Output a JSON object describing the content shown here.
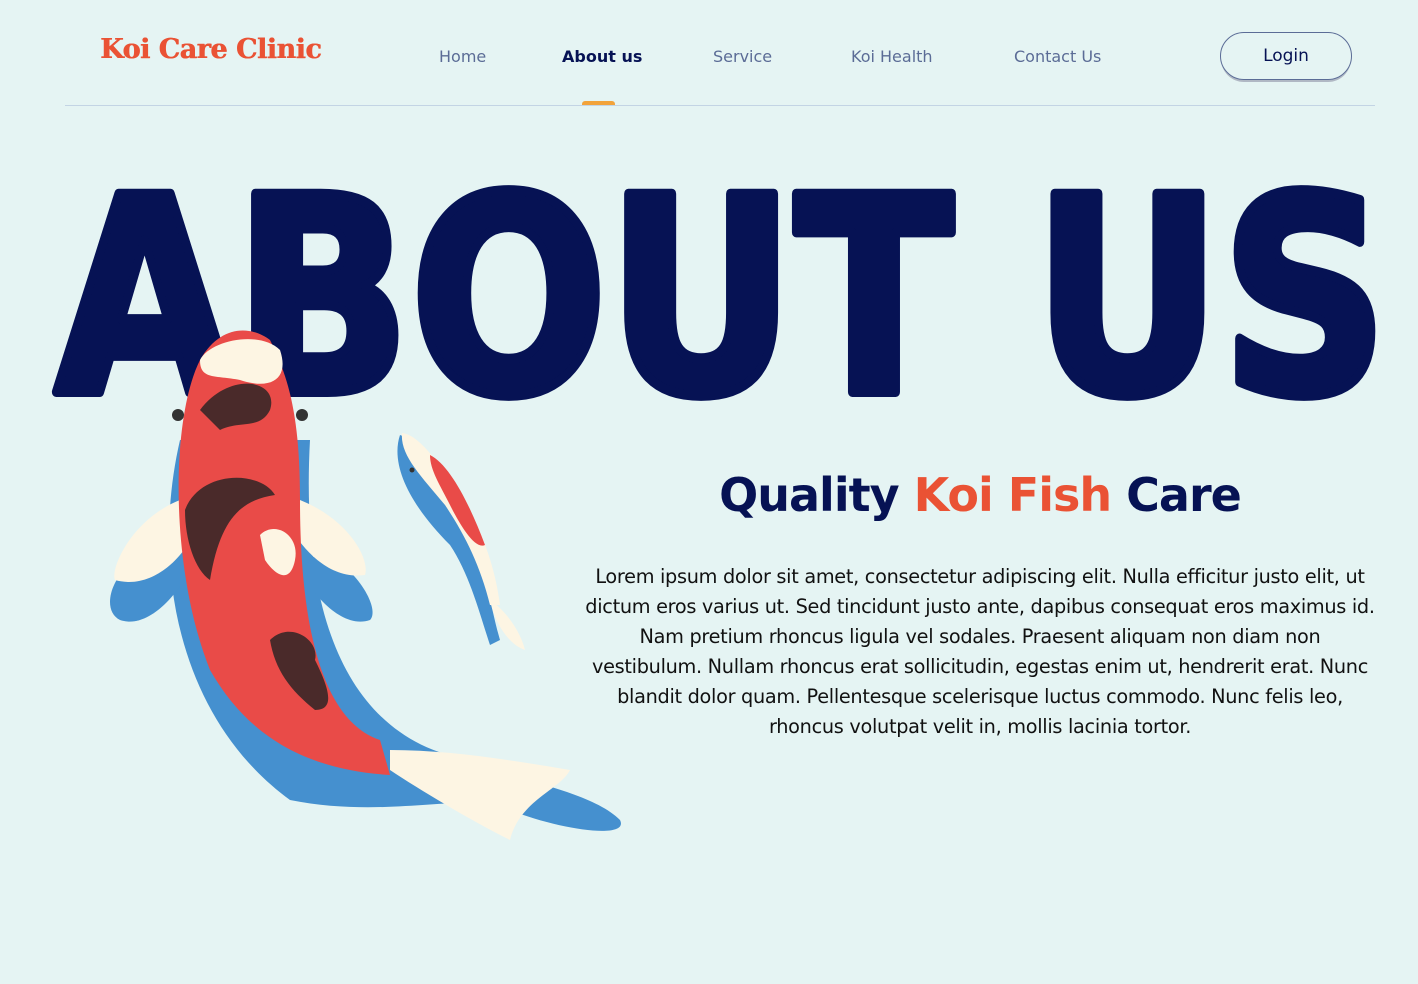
{
  "header": {
    "logo": "Koi Care Clinic",
    "nav": [
      {
        "label": "Home",
        "active": false
      },
      {
        "label": "About us",
        "active": true
      },
      {
        "label": "Service",
        "active": false
      },
      {
        "label": "Koi Health",
        "active": false
      },
      {
        "label": "Contact Us",
        "active": false
      }
    ],
    "login_label": "Login"
  },
  "hero": {
    "title": "ABOUT US",
    "subtitle_pre": "Quality ",
    "subtitle_accent": "Koi Fish",
    "subtitle_post": " Care",
    "body": "Lorem ipsum dolor sit amet, consectetur adipiscing elit. Nulla efficitur justo elit, ut dictum eros varius ut. Sed tincidunt justo ante, dapibus consequat eros maximus id.  Nam pretium rhoncus ligula vel sodales. Praesent aliquam non diam non vestibulum.  Nullam rhoncus erat sollicitudin, egestas enim ut, hendrerit erat. Nunc blandit dolor quam. Pellentesque scelerisque luctus commodo. Nunc felis leo, rhoncus volutpat velit in, mollis lacinia tortor."
  },
  "colors": {
    "navy": "#061254",
    "accent": "#ea5234",
    "active_indicator": "#f2a33a",
    "background": "#e5f4f3"
  }
}
